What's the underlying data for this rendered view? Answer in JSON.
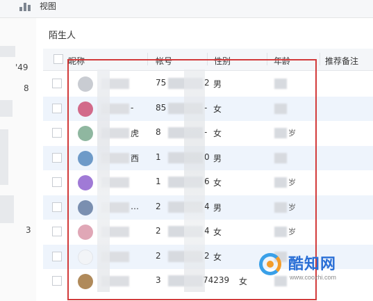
{
  "toolbar": {
    "view_label": "视图",
    "icon": "bar-chart-icon"
  },
  "sidebar": {
    "fragments": [
      "'49",
      "8",
      "3"
    ]
  },
  "group": {
    "title": "陌生人"
  },
  "columns": {
    "nickname": "昵称",
    "account": "帐号",
    "gender": "性别",
    "age": "年龄",
    "remark": "推荐备注"
  },
  "rows": [
    {
      "nick_frag": "",
      "acc_pre": "75",
      "acc_suf": "2",
      "gender": "男",
      "age_frag": "",
      "avatar_color": "#c9ccd2"
    },
    {
      "nick_frag": "-",
      "acc_pre": "85",
      "acc_suf": "-",
      "gender": "女",
      "age_frag": "",
      "avatar_color": "#d26a8a"
    },
    {
      "nick_frag": "虎",
      "acc_pre": "8",
      "acc_suf": "-",
      "gender": "女",
      "age_frag": "岁",
      "avatar_color": "#8fb7a0"
    },
    {
      "nick_frag": "西",
      "acc_pre": "1",
      "acc_suf": "0",
      "gender": "男",
      "age_frag": "",
      "avatar_color": "#6e9ac8"
    },
    {
      "nick_frag": "",
      "acc_pre": "1",
      "acc_suf": "6",
      "gender": "女",
      "age_frag": "岁",
      "avatar_color": "#a07ad6"
    },
    {
      "nick_frag": "…",
      "acc_pre": "2",
      "acc_suf": "4",
      "gender": "男",
      "age_frag": "岁",
      "avatar_color": "#7a8fb0"
    },
    {
      "nick_frag": "",
      "acc_pre": "2",
      "acc_suf": "4",
      "gender": "女",
      "age_frag": "岁",
      "avatar_color": "#e0a7b6"
    },
    {
      "nick_frag": "",
      "acc_pre": "2",
      "acc_suf": "2",
      "gender": "女",
      "age_frag": "",
      "avatar_color": "#f2f4f7"
    },
    {
      "nick_frag": "",
      "acc_pre": "3",
      "acc_suf": "74239",
      "gender": "女",
      "age_frag": "",
      "avatar_color": "#b08a5a"
    }
  ],
  "watermark": {
    "name": "酷知网",
    "url": "www.coozhi.com"
  },
  "colors": {
    "highlight": "#d23a3a",
    "alt_row": "#eef4fc",
    "brand_blue": "#2a6fd6",
    "brand_orange": "#f39c2b"
  }
}
